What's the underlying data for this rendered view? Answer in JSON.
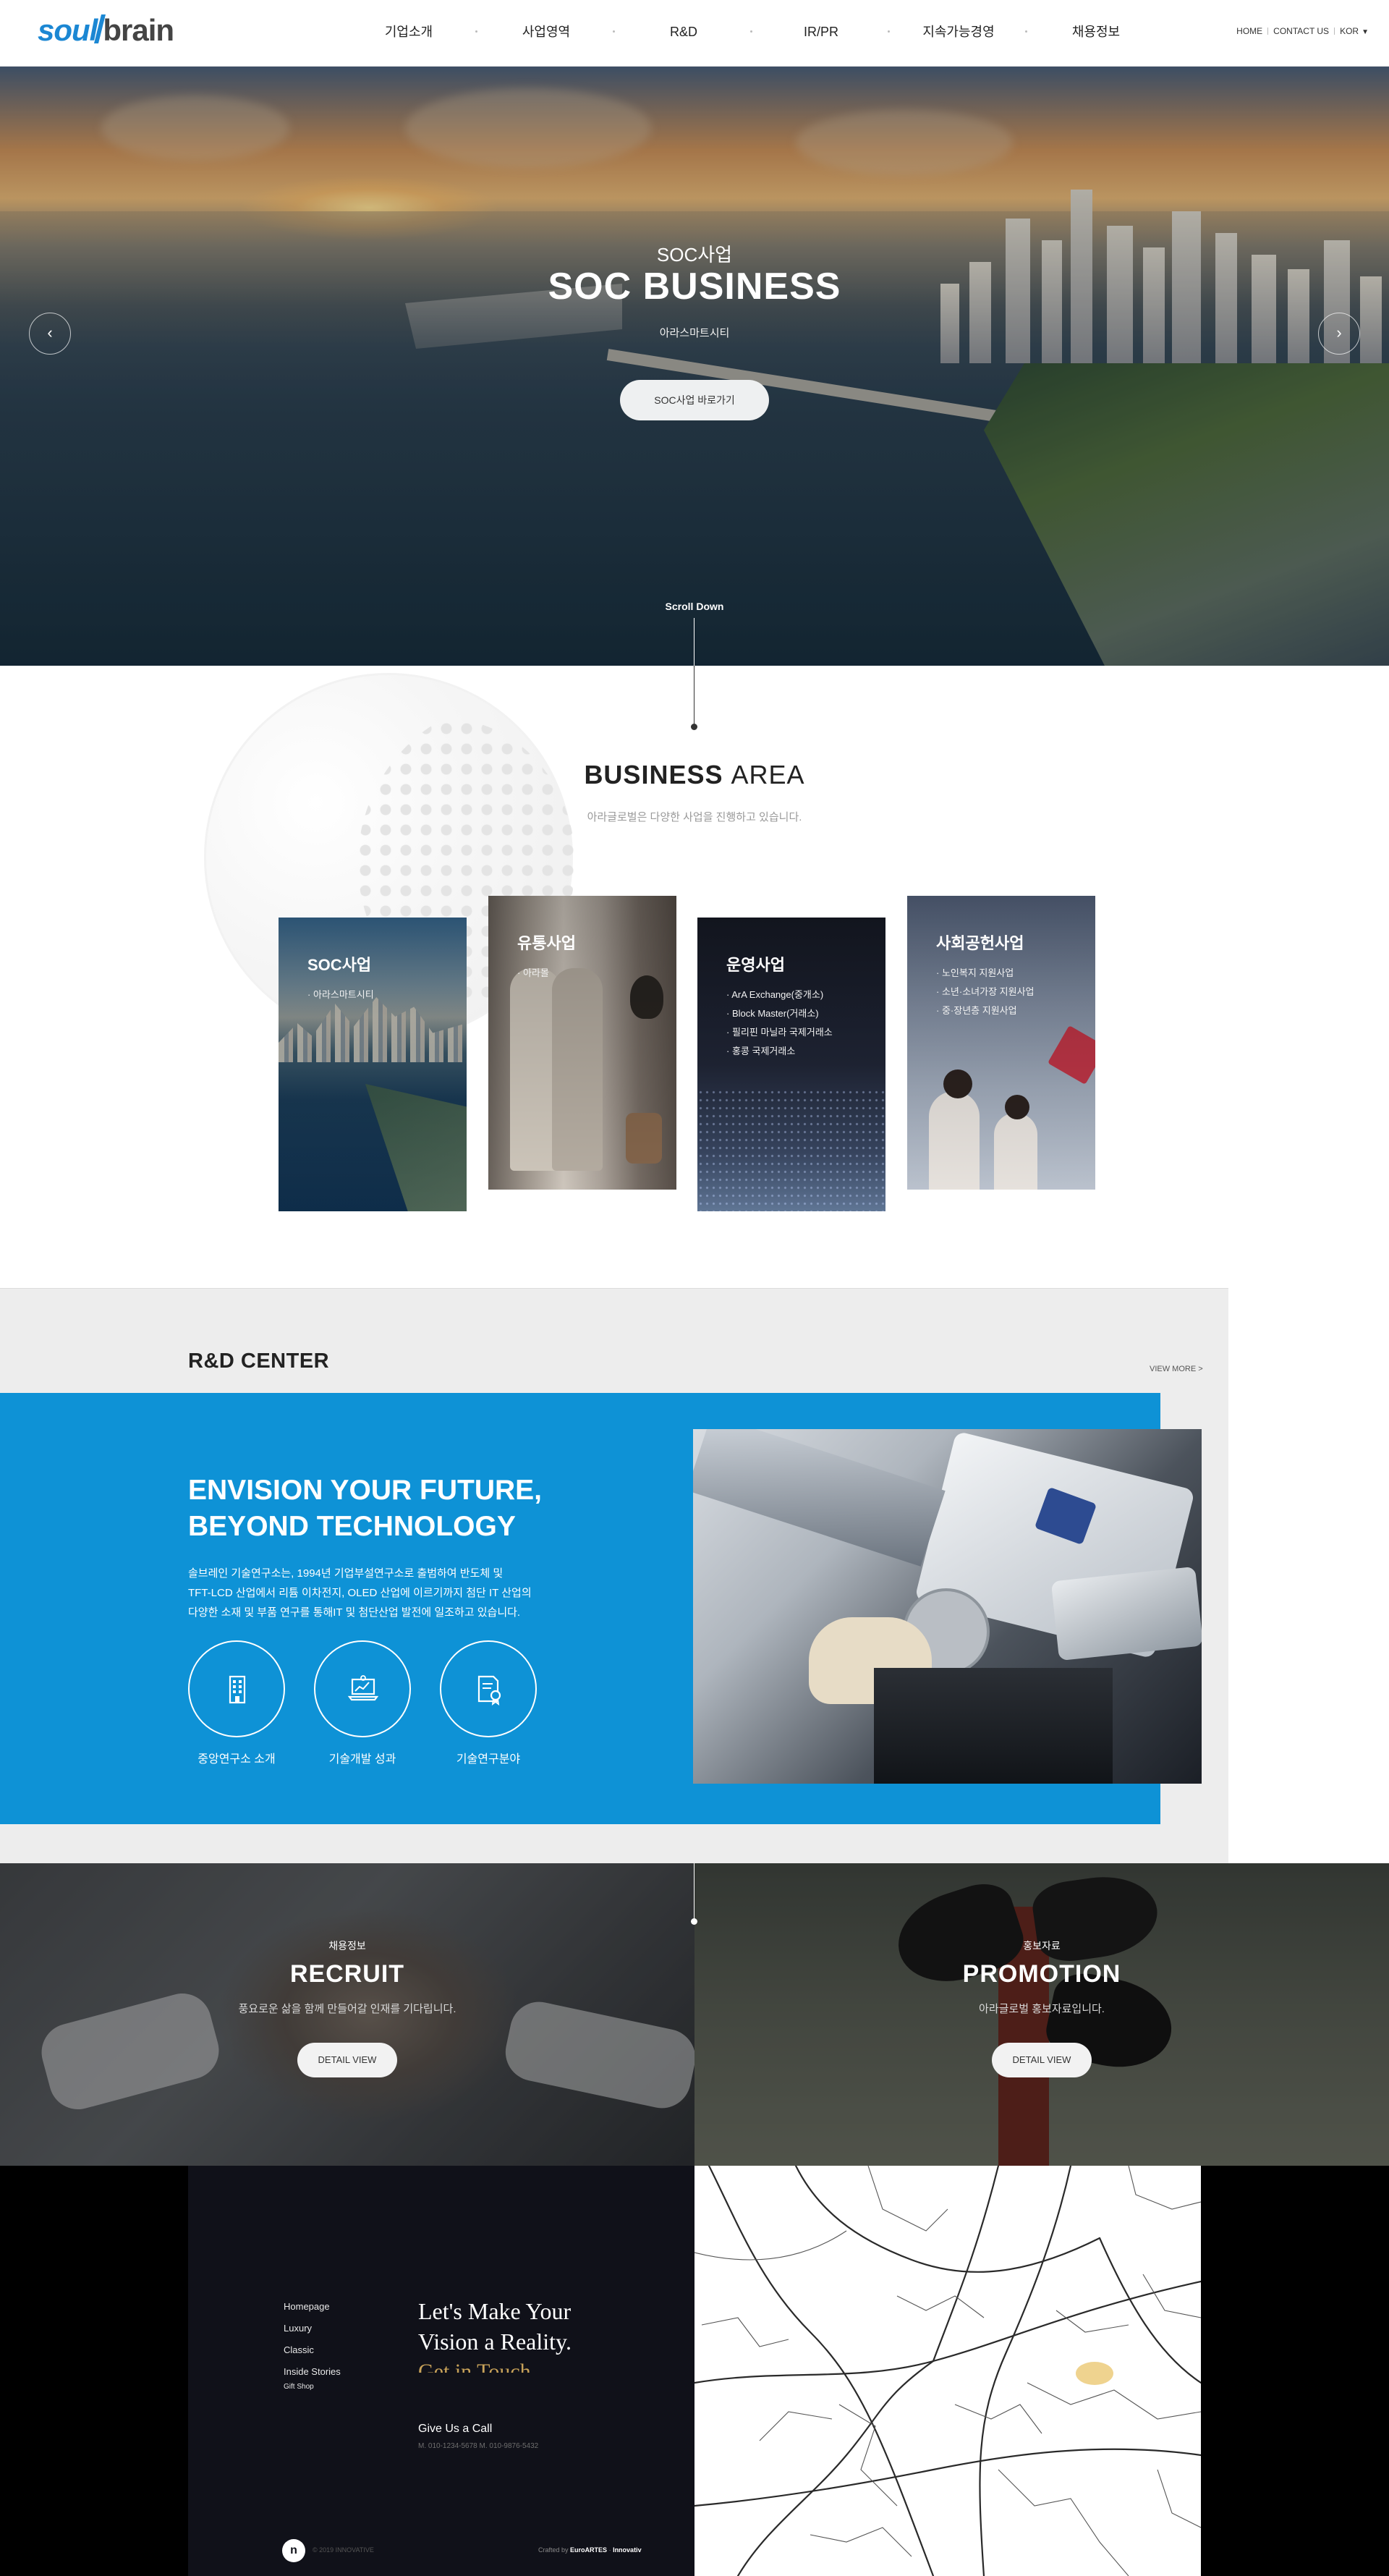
{
  "header": {
    "logo_a": "soul",
    "logo_b": "brain",
    "nav": [
      "기업소개",
      "사업영역",
      "R&D",
      "IR/PR",
      "지속가능경영",
      "채용정보"
    ],
    "util": {
      "home": "HOME",
      "contact": "CONTACT US",
      "lang": "KOR"
    }
  },
  "hero": {
    "sub": "SOC사업",
    "title": "SOC BUSINESS",
    "desc": "아라스마트시티",
    "button": "SOC사업 바로가기",
    "scroll": "Scroll Down"
  },
  "business": {
    "title_bold": "BUSINESS",
    "title_light": "AREA",
    "desc": "아라글로벌은 다양한 사업을 진행하고 있습니다.",
    "cards": [
      {
        "title": "SOC사업",
        "items": [
          "아라스마트시티"
        ]
      },
      {
        "title": "유통사업",
        "items": [
          "아라몰"
        ]
      },
      {
        "title": "운영사업",
        "items": [
          "ArA Exchange(중개소)",
          "Block Master(거래소)",
          "필리핀 마닐라 국제거래소",
          "홍콩 국제거래소"
        ]
      },
      {
        "title": "사회공헌사업",
        "items": [
          "노인복지 지원사업",
          "소년·소녀가장 지원사업",
          "중·장년층 지원사업"
        ]
      }
    ]
  },
  "rnd": {
    "title": "R&D CENTER",
    "view_more": "VIEW MORE >",
    "headline": "ENVISION YOUR FUTURE,\nBEYOND TECHNOLOGY",
    "body": "솔브레인 기술연구소는, 1994년 기업부설연구소로 출범하여 반도체 및\nTFT-LCD 산업에서 리튬 이차전지, OLED 산업에 이르기까지 첨단 IT 산업의\n다양한 소재 및 부품 연구를 통해IT 및 첨단산업 발전에 일조하고 있습니다.",
    "icons": [
      {
        "label": "중앙연구소 소개",
        "icon": "building-icon"
      },
      {
        "label": "기술개발 성과",
        "icon": "chart-laptop-icon"
      },
      {
        "label": "기술연구분야",
        "icon": "certificate-icon"
      }
    ]
  },
  "promo": {
    "recruit": {
      "kicker": "채용정보",
      "title": "RECRUIT",
      "desc": "풍요로운 삶을 함께 만들어갈 인재를 기다립니다.",
      "button": "DETAIL VIEW"
    },
    "promotion": {
      "kicker": "홍보자료",
      "title": "PROMOTION",
      "desc": "아라글로벌 홍보자료입니다.",
      "button": "DETAIL VIEW"
    }
  },
  "bottom": {
    "menu": [
      "Homepage",
      "Luxury",
      "Classic",
      "Inside Stories",
      "Gift Shop"
    ],
    "lets": "Let's Make Your\nVision a Reality.",
    "gold": "Get in Touch",
    "give": "Give Us a Call",
    "phones": "M. 010-1234-5678    M. 010-9876-5432",
    "logo_letter": "n",
    "copyright": "© 2019 INNOVATIVE",
    "credit_prefix": "Crafted by",
    "credit_a": "EuroARTES",
    "credit_b": "Innovativ"
  },
  "colors": {
    "accent": "#0e92d6",
    "brand": "#1b87d3",
    "gold": "#c9a35a"
  }
}
